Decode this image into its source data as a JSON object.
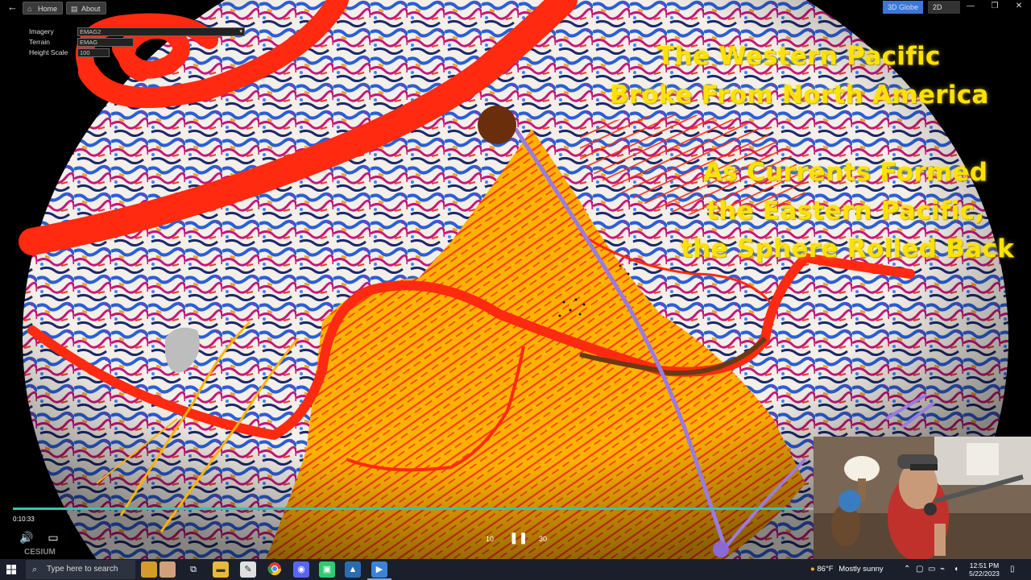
{
  "app": {
    "back_symbol": "←",
    "home_label": "Home",
    "about_label": "About",
    "view_3d_label": "3D Globe",
    "view_2d_label": "2D Map"
  },
  "layers": {
    "imagery_label": "Imagery",
    "terrain_label": "Terrain",
    "height_label": "Height Scale",
    "imagery_value": "EMAG2",
    "terrain_value": "EMAG",
    "height_value": "100"
  },
  "overlay": {
    "line1": "The Western Pacific",
    "line2": "Broke From North America",
    "line3": "As Currents Formed",
    "line4": "the Eastern Pacific,",
    "line5": "the Sphere Rolled Back"
  },
  "video": {
    "current_time": "0:10:33",
    "progress": 0.98,
    "replay_label": "10",
    "forward_label": "30"
  },
  "brand": {
    "name": "CESIUM"
  },
  "taskbar": {
    "search_placeholder": "Type here to search",
    "weather_temp": "86°F",
    "weather_text": "Mostly sunny",
    "time": "12:51 PM",
    "date": "5/22/2023"
  },
  "colors": {
    "accent_progress": "#30c6b0",
    "title_yellow": "#ffe100",
    "drawing_red": "#ff2a10",
    "drawing_orange": "#ffb300",
    "drawing_purple": "#9a7be0"
  },
  "icons": [
    "back-arrow-icon",
    "home-icon",
    "about-icon",
    "volume-icon",
    "captions-icon",
    "replay-10-icon",
    "pause-icon",
    "forward-30-icon",
    "windows-start-icon",
    "search-icon",
    "task-view-icon",
    "file-explorer-icon",
    "chrome-icon",
    "discord-icon",
    "weather-icon",
    "notification-icon"
  ]
}
